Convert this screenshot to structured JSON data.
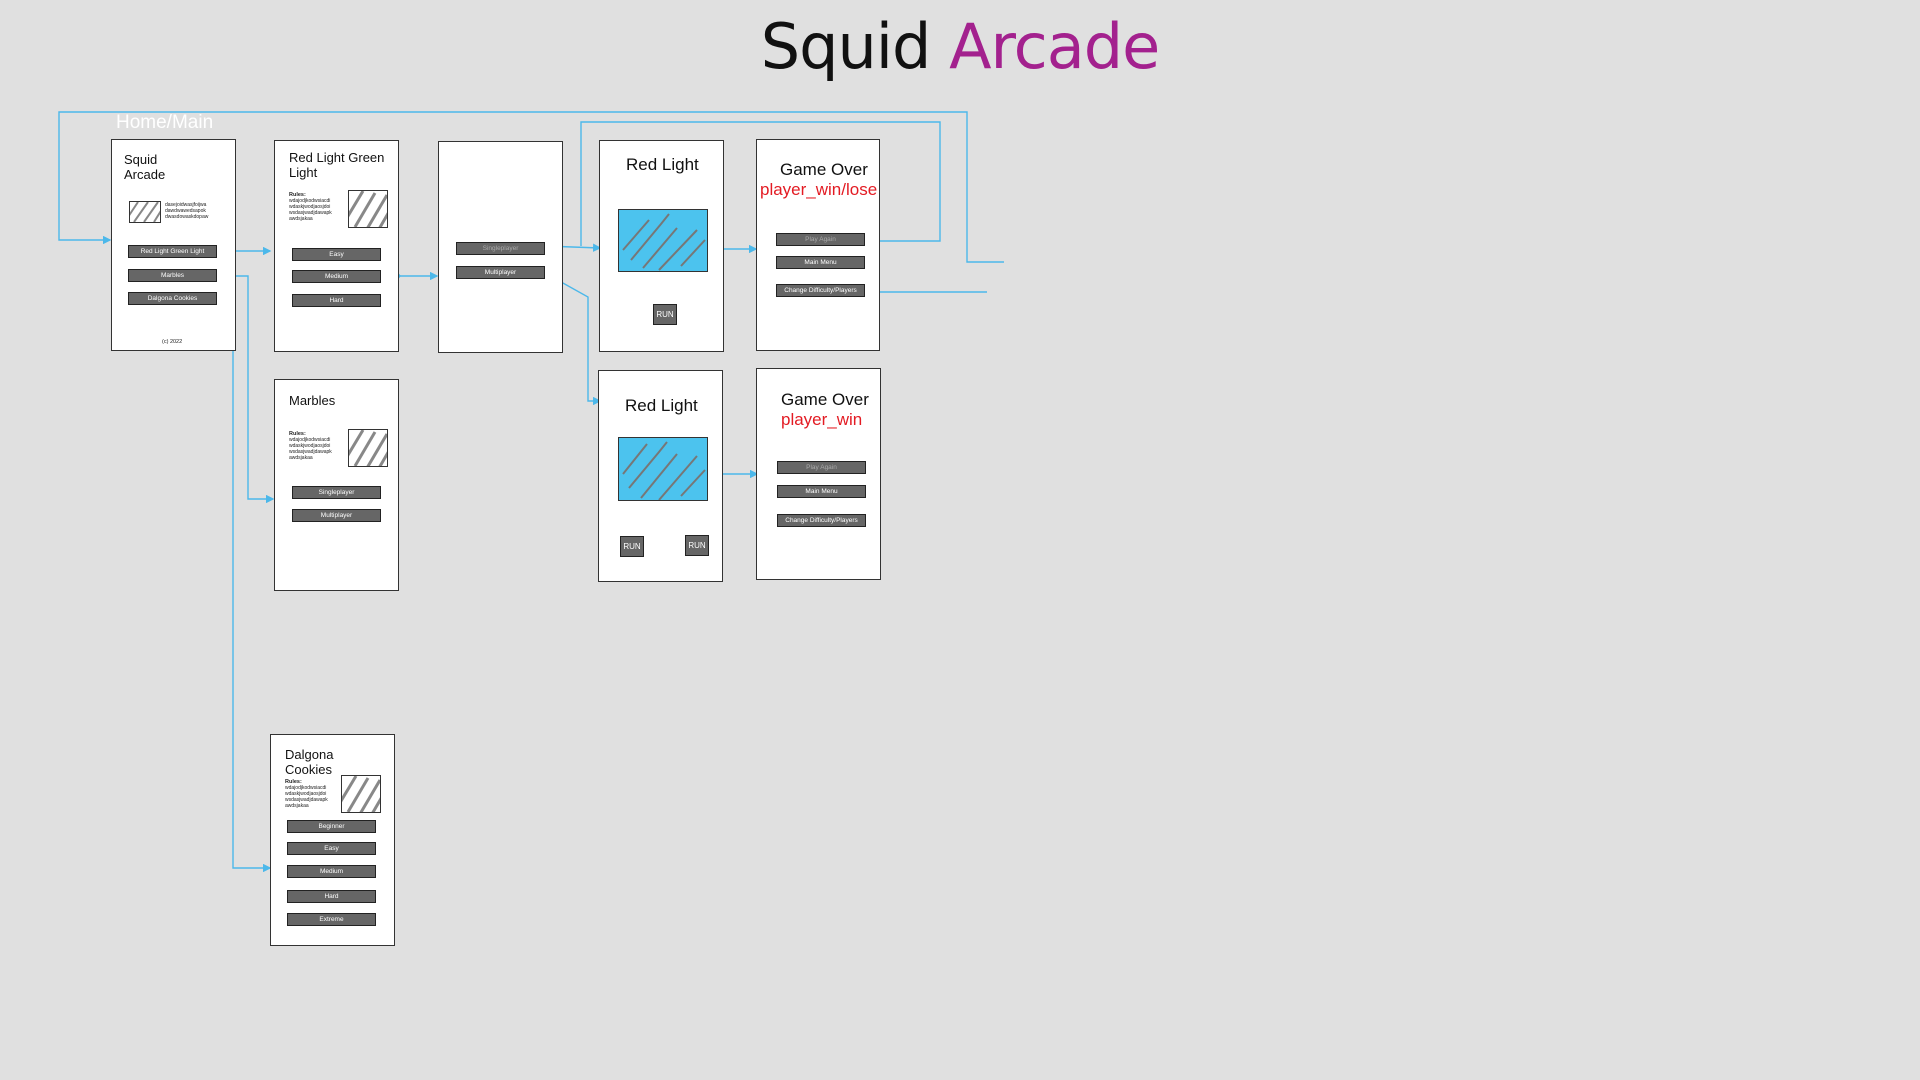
{
  "header": {
    "title_part1": "Squid",
    "title_part2": "Arcade"
  },
  "section_label": "Home/Main",
  "home": {
    "title_line1": "Squid",
    "title_line2": "Arcade",
    "description": "dasejoidwasjfoijwa dawdwawedsapok dwasdowaskdopaw",
    "buttons": [
      "Red Light Green Light",
      "Marbles",
      "Dalgona Cookies"
    ],
    "copyright": "(c) 2022"
  },
  "rlgl": {
    "title_line1": "Red Light Green",
    "title_line2": "Light",
    "rules": "Rules: wdajodjkodwsiacdi wdaskjwodjaosjdoi wsdasjwadjdawapk awdsjakaa",
    "buttons": [
      "Easy",
      "Medium",
      "Hard"
    ]
  },
  "players": {
    "buttons": [
      "Singleplayer",
      "Multiplayer"
    ]
  },
  "game_single": {
    "title": "Red Light",
    "run_label": "RUN"
  },
  "game_multi": {
    "title": "Red Light",
    "run_left": "RUN",
    "run_right": "RUN"
  },
  "over_single": {
    "title": "Game Over",
    "subtitle": "player_win/lose",
    "buttons": [
      "Play Again",
      "Main Menu",
      "Change Difficulty/Players"
    ]
  },
  "over_multi": {
    "title": "Game Over",
    "subtitle": "player_win",
    "buttons": [
      "Play Again",
      "Main Menu",
      "Change Difficulty/Players"
    ]
  },
  "marbles": {
    "title": "Marbles",
    "rules": "Rules: wdajodjkodwsiacdi wdaskjwodjaosjdoi wsdasjwadjdawapk awdsjakaa",
    "buttons": [
      "Singleplayer",
      "Multiplayer"
    ]
  },
  "dalgona": {
    "title_line1": "Dalgona",
    "title_line2": "Cookies",
    "rules": "Rules: wdajodjkodwsiacdi wdaskjwodjaosjdoi wsdasjwadjdawapk awdsjakaa",
    "buttons": [
      "Beginner",
      "Easy",
      "Medium",
      "Hard",
      "Extreme"
    ]
  },
  "colors": {
    "connector": "#4cb8ea",
    "accent": "#a3218e",
    "warning_text": "#e31b23",
    "game_area": "#4cc3ee"
  }
}
